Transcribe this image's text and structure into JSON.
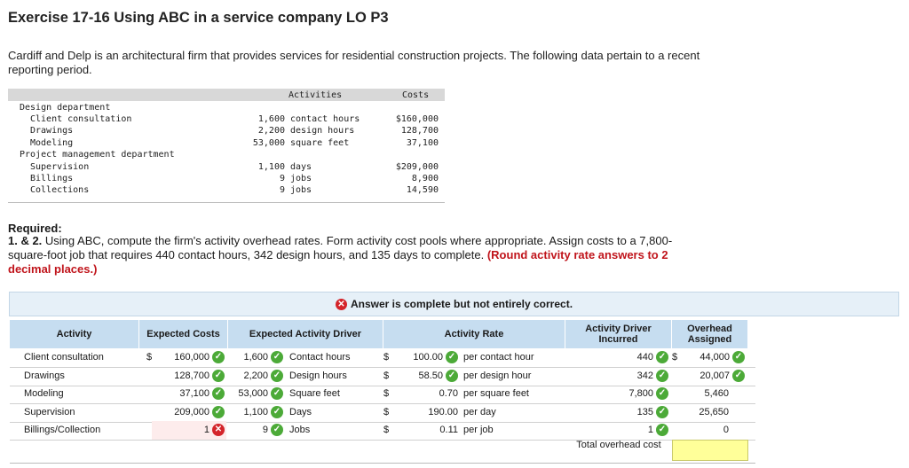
{
  "title": "Exercise 17-16 Using ABC in a service company LO P3",
  "intro": "Cardiff and Delp is an architectural firm that provides services for residential construction projects. The following data pertain to a recent reporting period.",
  "data_table": {
    "header_activities": "Activities",
    "header_costs": "Costs",
    "lines": [
      {
        "label": "Design department",
        "indent": 0,
        "qty": "",
        "unit": "",
        "cost": ""
      },
      {
        "label": "Client consultation",
        "indent": 1,
        "qty": "1,600",
        "unit": "contact hours",
        "cost": "$160,000"
      },
      {
        "label": "Drawings",
        "indent": 1,
        "qty": "2,200",
        "unit": "design hours",
        "cost": "128,700"
      },
      {
        "label": "Modeling",
        "indent": 1,
        "qty": "53,000",
        "unit": "square feet",
        "cost": "37,100"
      },
      {
        "label": "Project management department",
        "indent": 0,
        "qty": "",
        "unit": "",
        "cost": ""
      },
      {
        "label": "Supervision",
        "indent": 1,
        "qty": "1,100",
        "unit": "days",
        "cost": "$209,000"
      },
      {
        "label": "Billings",
        "indent": 1,
        "qty": "9",
        "unit": "jobs",
        "cost": "8,900"
      },
      {
        "label": "Collections",
        "indent": 1,
        "qty": "9",
        "unit": "jobs",
        "cost": "14,590"
      }
    ]
  },
  "required": {
    "heading": "Required:",
    "lead": "1. & 2.",
    "text": " Using ABC, compute the firm's activity overhead rates. Form activity cost pools where appropriate. Assign costs to a 7,800-square-foot job that requires 440 contact hours, 342 design hours, and 135 days to complete. ",
    "note": "(Round activity rate answers to 2 decimal places.)"
  },
  "banner": "Answer is complete but not entirely correct.",
  "answer_table": {
    "headers": {
      "activity": "Activity",
      "expected_costs": "Expected Costs",
      "expected_driver": "Expected Activity Driver",
      "activity_rate": "Activity Rate",
      "driver_incurred": "Activity Driver Incurred",
      "overhead_assigned": "Overhead Assigned"
    },
    "rows": [
      {
        "activity": "Client consultation",
        "cost_dollar": "$",
        "cost": "160,000",
        "cost_status": "correct",
        "driver_qty": "1,600",
        "driver_unit": "Contact hours",
        "rate_dollar": "$",
        "rate": "100.00",
        "rate_unit": "per contact hour",
        "incurred": "440",
        "assigned_dollar": "$",
        "assigned": "44,000",
        "assigned_status": "correct"
      },
      {
        "activity": "Drawings",
        "cost_dollar": "",
        "cost": "128,700",
        "cost_status": "correct",
        "driver_qty": "2,200",
        "driver_unit": "Design hours",
        "rate_dollar": "$",
        "rate": "58.50",
        "rate_unit": "per design hour",
        "incurred": "342",
        "assigned_dollar": "",
        "assigned": "20,007",
        "assigned_status": "correct"
      },
      {
        "activity": "Modeling",
        "cost_dollar": "",
        "cost": "37,100",
        "cost_status": "correct",
        "driver_qty": "53,000",
        "driver_unit": "Square feet",
        "rate_dollar": "$",
        "rate": "0.70",
        "rate_unit": "per square feet",
        "incurred": "7,800",
        "assigned_dollar": "",
        "assigned": "5,460",
        "assigned_status": "none"
      },
      {
        "activity": "Supervision",
        "cost_dollar": "",
        "cost": "209,000",
        "cost_status": "correct",
        "driver_qty": "1,100",
        "driver_unit": "Days",
        "rate_dollar": "$",
        "rate": "190.00",
        "rate_unit": "per day",
        "incurred": "135",
        "assigned_dollar": "",
        "assigned": "25,650",
        "assigned_status": "none"
      },
      {
        "activity": "Billings/Collection",
        "cost_dollar": "",
        "cost": "1",
        "cost_status": "incorrect",
        "driver_qty": "9",
        "driver_unit": "Jobs",
        "rate_dollar": "$",
        "rate": "0.11",
        "rate_unit": "per job",
        "incurred": "1",
        "assigned_dollar": "",
        "assigned": "0",
        "assigned_status": "none"
      }
    ],
    "total_label": "Total overhead cost",
    "total_value": ""
  },
  "colors": {
    "header_blue": "#c6ddf0",
    "check_green": "#4caa38",
    "error_red": "#d4242a",
    "note_red": "#c0141b",
    "total_yellow": "#ffff99"
  }
}
